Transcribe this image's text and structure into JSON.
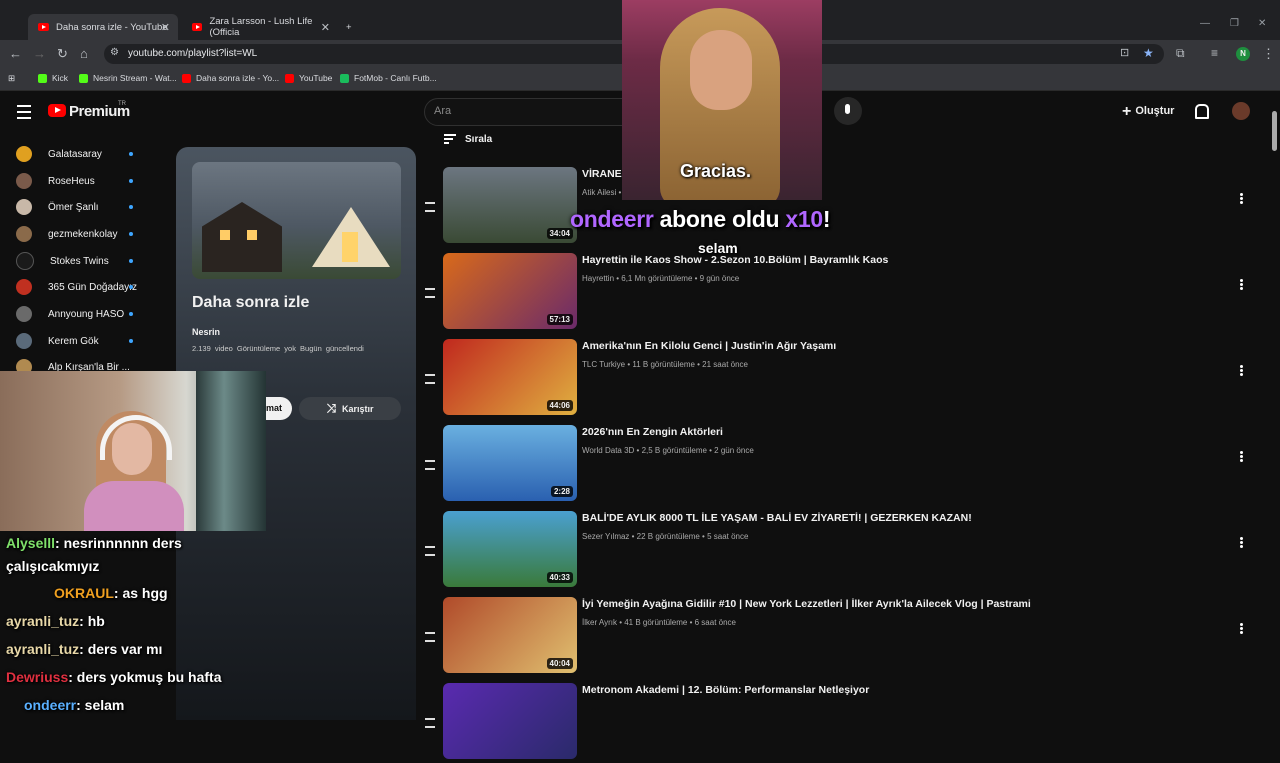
{
  "browser": {
    "tabs": [
      {
        "label": "Daha sonra izle - YouTube",
        "active": true
      },
      {
        "label": "Zara Larsson - Lush Life (Officia",
        "active": false
      }
    ],
    "new_tab": "+",
    "url": "youtube.com/playlist?list=WL",
    "bookmarks": [
      "Kick",
      "Nesrin Stream - Wat...",
      "Daha sonra izle - Yo...",
      "YouTube",
      "FotMob - Canlı Futb..."
    ],
    "profile_initial": "N"
  },
  "youtube": {
    "logo_text": "Premium",
    "logo_sup": "TR",
    "search_placeholder": "Ara",
    "create_label": "Oluştur"
  },
  "sidebar": {
    "items": [
      {
        "label": "Galatasaray",
        "color": "#e0a020"
      },
      {
        "label": "RoseHeus",
        "color": "#7a5a4a"
      },
      {
        "label": "Ömer Şanlı",
        "color": "#c8b8a8"
      },
      {
        "label": "gezmekenkolay",
        "color": "#8a6a4a"
      },
      {
        "label": "Stokes Twins",
        "color": "#1a1a1a"
      },
      {
        "label": "365 Gün Doğadayız",
        "color": "#c03020"
      },
      {
        "label": "Annyoung HASO",
        "color": "#6a6a6a"
      },
      {
        "label": "Kerem Gök",
        "color": "#5a6a7a"
      },
      {
        "label": "Alp Kırşan'la Bir ...",
        "color": "#b08a50"
      }
    ]
  },
  "playlist": {
    "title": "Daha sonra izle",
    "owner": "Nesrin",
    "meta": "2.139 video  Görüntüleme yok  Bugün güncellendi",
    "play_label": "mat",
    "shuffle_label": "Karıştır"
  },
  "sort_label": "Sırala",
  "videos": [
    {
      "title": "VİRANE KÖY EVİMİZİ",
      "meta": "Atik Ailesi •",
      "duration": "34:04",
      "bg": "linear-gradient(180deg,#6c7681,#3a4a35)"
    },
    {
      "title": "Hayrettin ile Kaos Show - 2.Sezon 10.Bölüm | Bayramlık Kaos",
      "meta": "Hayrettin • 6,1 Mn görüntüleme • 9 gün önce",
      "duration": "57:13",
      "bg": "linear-gradient(135deg,#d96a1a,#6a2a6a)"
    },
    {
      "title": "Amerika'nın En Kilolu Genci | Justin'in Ağır Yaşamı",
      "meta": "TLC Turkiye • 11 B görüntüleme • 21 saat önce",
      "duration": "44:06",
      "bg": "linear-gradient(135deg,#c0281e,#e0b040)"
    },
    {
      "title": "2026'nın En Zengin Aktörleri",
      "meta": "World Data 3D • 2,5 B görüntüleme • 2 gün önce",
      "duration": "2:28",
      "bg": "linear-gradient(180deg,#6ab0e0,#2a60b0)"
    },
    {
      "title": "BALİ'DE AYLIK 8000 TL İLE YAŞAM - BALİ EV ZİYARETİ! | GEZERKEN KAZAN!",
      "meta": "Sezer Yılmaz • 22 B görüntüleme • 5 saat önce",
      "duration": "40:33",
      "bg": "linear-gradient(180deg,#4aa0d0,#3a7a3a)"
    },
    {
      "title": "İyi Yemeğin Ayağına Gidilir #10 | New York Lezzetleri | İlker Ayrık'la Ailecek Vlog | Pastrami",
      "meta": "İlker Ayrık • 41 B görüntüleme • 6 saat önce",
      "duration": "40:04",
      "bg": "linear-gradient(135deg,#b04a2a,#e0c070)"
    },
    {
      "title": "Metronom Akademi | 12. Bölüm: Performanslar Netleşiyor",
      "meta": "",
      "duration": "",
      "bg": "linear-gradient(135deg,#5a2ab0,#2a2a6a)"
    }
  ],
  "stream_overlay": {
    "caption": "Gracias.",
    "alert_user": "ondeerr",
    "alert_text": "abone oldu",
    "alert_count": "x10",
    "alert_message": "selam"
  },
  "chat": [
    {
      "user": "Alyselll",
      "message": ": nesrinnnnnn ders",
      "color": "#7fe06a"
    },
    {
      "user": "",
      "message": "çalışıcakmıyız",
      "color": "#ffffff"
    },
    {
      "user": "OKRAUL",
      "message": ": as hgg",
      "color": "#f0a020"
    },
    {
      "user": "ayranli_tuz",
      "message": ": hb",
      "color": "#e8d8a8"
    },
    {
      "user": "ayranli_tuz",
      "message": ": ders var mı",
      "color": "#e8d8a8"
    },
    {
      "user": "Dewriuss",
      "message": ": ders yokmuş bu hafta",
      "color": "#e03040"
    },
    {
      "user": "ondeerr",
      "message": ": selam",
      "color": "#5ab0ff"
    }
  ]
}
